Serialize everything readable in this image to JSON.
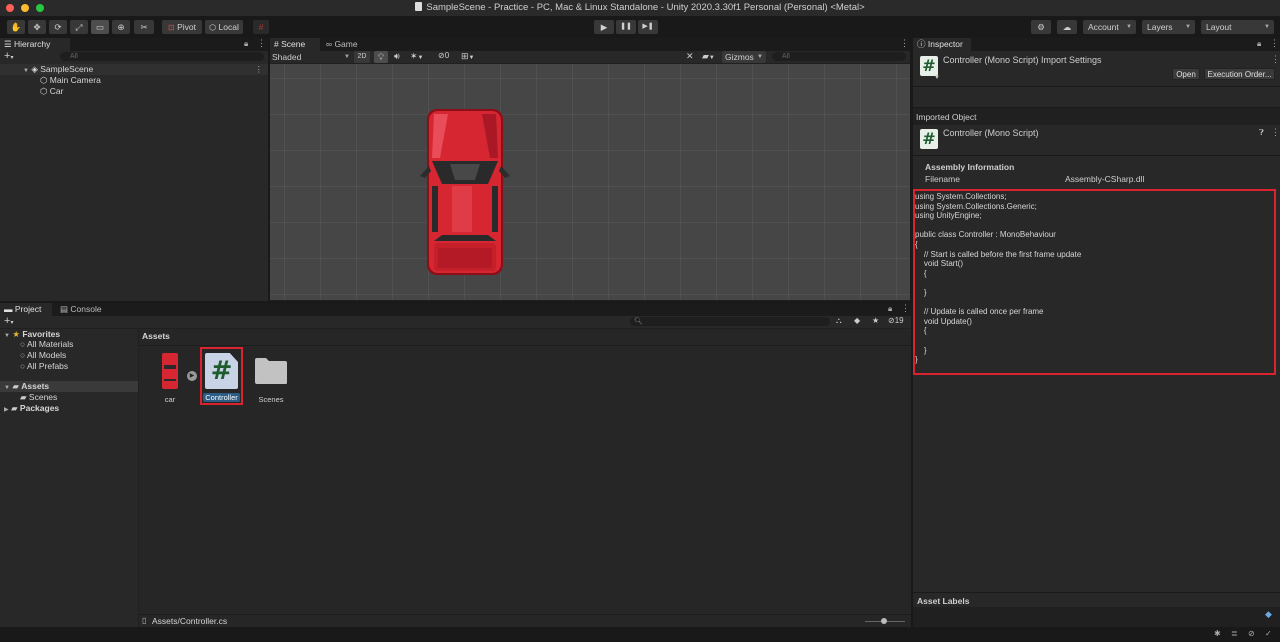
{
  "window": {
    "title": "SampleScene - Practice - PC, Mac & Linux Standalone - Unity 2020.3.30f1 Personal (Personal) <Metal>"
  },
  "toolbar": {
    "pivot_label": "Pivot",
    "local_label": "Local",
    "account_label": "Account",
    "layers_label": "Layers",
    "layout_label": "Layout"
  },
  "hierarchy": {
    "tab_label": "Hierarchy",
    "search_placeholder": "All",
    "scene_name": "SampleScene",
    "items": [
      {
        "label": "Main Camera"
      },
      {
        "label": "Car"
      }
    ]
  },
  "scene": {
    "tab_scene": "Scene",
    "tab_game": "Game",
    "shading_mode": "Shaded",
    "mode_2d": "2D",
    "hidden_count": "0",
    "gizmos_label": "Gizmos",
    "search_placeholder": "All"
  },
  "project": {
    "tab_project": "Project",
    "tab_console": "Console",
    "favorites_label": "Favorites",
    "favorites": [
      "All Materials",
      "All Models",
      "All Prefabs"
    ],
    "assets_label": "Assets",
    "assets_children": [
      "Scenes"
    ],
    "packages_label": "Packages",
    "breadcrumb": "Assets",
    "hidden_count": "19",
    "items": [
      {
        "label": "car",
        "icon": "car-sprite-icon"
      },
      {
        "label": "Controller",
        "icon": "csharp-script-icon"
      },
      {
        "label": "Scenes",
        "icon": "folder-icon"
      }
    ],
    "status_path": "Assets/Controller.cs"
  },
  "inspector": {
    "tab_label": "Inspector",
    "header_title": "Controller (Mono Script) Import Settings",
    "open_button": "Open",
    "execution_order_button": "Execution Order...",
    "imported_object_label": "Imported Object",
    "object_title": "Controller (Mono Script)",
    "assembly_info_label": "Assembly Information",
    "filename_label": "Filename",
    "filename_value": "Assembly-CSharp.dll",
    "code_lines": [
      "using System.Collections;",
      "using System.Collections.Generic;",
      "using UnityEngine;",
      "",
      "public class Controller : MonoBehaviour",
      "{",
      "    // Start is called before the first frame update",
      "    void Start()",
      "    {",
      "",
      "    }",
      "",
      "    // Update is called once per frame",
      "    void Update()",
      "    {",
      "",
      "    }",
      "}"
    ],
    "asset_labels_label": "Asset Labels"
  },
  "colors": {
    "highlight_red": "#d9232e",
    "car_red": "#d62632",
    "selection_blue": "#2c5d87"
  }
}
